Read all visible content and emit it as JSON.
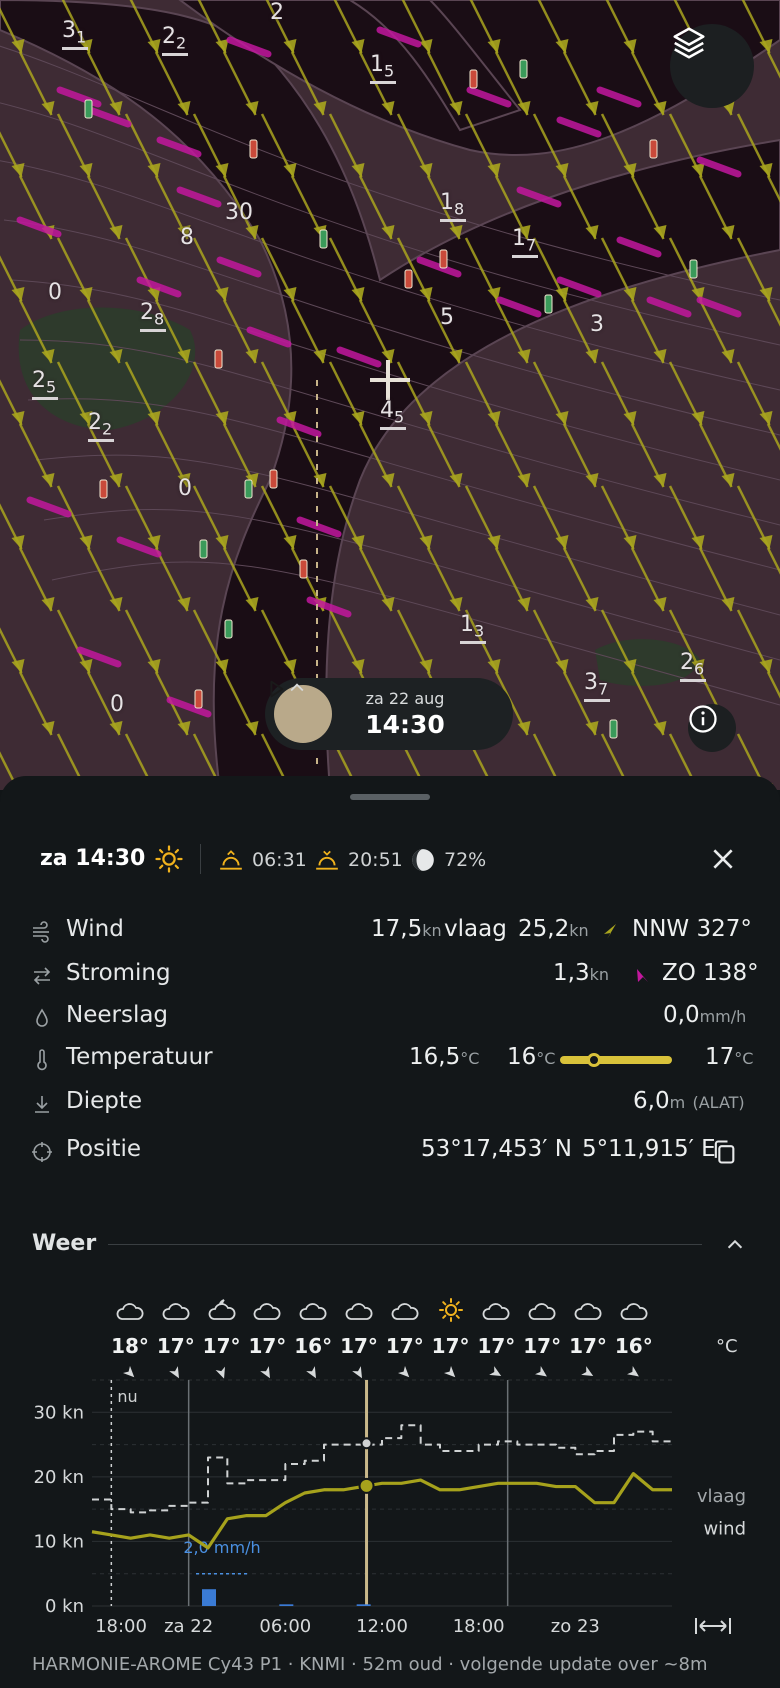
{
  "map": {
    "depth_labels": [
      {
        "main": "3",
        "sub": "1"
      },
      {
        "main": "2",
        "sub": "2"
      },
      {
        "main": "1",
        "sub": "5"
      },
      {
        "main": "1",
        "sub": "8"
      },
      {
        "main": "1",
        "sub": "7"
      },
      {
        "main": "2",
        "sub": "8"
      },
      {
        "main": "2",
        "sub": "5"
      },
      {
        "main": "2",
        "sub": "2"
      },
      {
        "main": "4",
        "sub": "5"
      },
      {
        "main": "1",
        "sub": "3"
      },
      {
        "main": "3",
        "sub": "7"
      },
      {
        "main": "2",
        "sub": "6"
      },
      {
        "main": "0",
        "sub": ""
      },
      {
        "main": "0",
        "sub": ""
      },
      {
        "main": "0",
        "sub": ""
      },
      {
        "main": "30",
        "sub": ""
      },
      {
        "main": "5",
        "sub": ""
      },
      {
        "main": "3",
        "sub": ""
      },
      {
        "main": "8",
        "sub": ""
      },
      {
        "main": "2",
        "sub": ""
      }
    ],
    "layers_icon": "layers-icon",
    "info_icon": "info-icon"
  },
  "timepill": {
    "date": "za 22 aug",
    "time": "14:30",
    "play_icon": "play-icon",
    "chevron_icon": "chevron-up-icon"
  },
  "sheet": {
    "header": {
      "title": "za 14:30",
      "sunrise": "06:31",
      "sunset": "20:51",
      "moon_pct": "72%"
    },
    "rows": {
      "wind": {
        "label": "Wind",
        "speed": "17,5",
        "speed_unit": "kn",
        "gust_label": "vlaag",
        "gust": "25,2",
        "gust_unit": "kn",
        "dir": "NNW 327°"
      },
      "current": {
        "label": "Stroming",
        "speed": "1,3",
        "unit": "kn",
        "dir": "ZO 138°"
      },
      "rain": {
        "label": "Neerslag",
        "value": "0,0",
        "unit": "mm/h"
      },
      "temp": {
        "label": "Temperatuur",
        "value": "16,5",
        "unit": "°C",
        "min": "16",
        "max": "17",
        "unit2": "°C",
        "unit3": "°C",
        "position_fraction": 0.3
      },
      "depth": {
        "label": "Diepte",
        "value": "6,0",
        "unit": "m",
        "ref": "(ALAT)"
      },
      "position": {
        "label": "Positie",
        "lat": "53°17,453′ N",
        "lon": "5°11,915′ E"
      }
    },
    "weather": {
      "section_title": "Weer",
      "temp_unit": "°C",
      "forecast": [
        {
          "icon": "cloud-icon",
          "temp": "18°"
        },
        {
          "icon": "cloud-icon",
          "temp": "17°"
        },
        {
          "icon": "moon-cloud-icon",
          "temp": "17°"
        },
        {
          "icon": "cloud-icon",
          "temp": "17°"
        },
        {
          "icon": "cloud-icon",
          "temp": "16°"
        },
        {
          "icon": "cloud-icon",
          "temp": "17°"
        },
        {
          "icon": "cloud-icon",
          "temp": "17°"
        },
        {
          "icon": "sun-icon",
          "temp": "17°"
        },
        {
          "icon": "cloud-icon",
          "temp": "17°"
        },
        {
          "icon": "cloud-icon",
          "temp": "17°"
        },
        {
          "icon": "cloud-icon",
          "temp": "17°"
        },
        {
          "icon": "cloud-icon",
          "temp": "16°"
        }
      ],
      "chart_data": {
        "type": "line",
        "y_ticks": [
          "30 kn",
          "20 kn",
          "10 kn",
          "0 kn"
        ],
        "ylim": [
          0,
          35
        ],
        "x_ticks": [
          "18:00",
          "za 22",
          "06:00",
          "12:00",
          "18:00",
          "zo 23"
        ],
        "now_label": "nu",
        "rain_annotation": "2,0 mm/h",
        "series": [
          {
            "name": "vlaag",
            "style": "dashed",
            "color": "#cfd2d3",
            "values": [
              16.5,
              15,
              14.5,
              14.8,
              15.5,
              16,
              23,
              19,
              19.5,
              19.5,
              22,
              22.5,
              25,
              25,
              25,
              26,
              28,
              25,
              24,
              24,
              25,
              25.5,
              25,
              25,
              24.5,
              23.5,
              24,
              26.5,
              27,
              25.5,
              25
            ]
          },
          {
            "name": "wind",
            "style": "solid",
            "color": "#a6a21c",
            "values": [
              11.5,
              11,
              10.5,
              11,
              10.5,
              11,
              9,
              13.5,
              14,
              14,
              16,
              17.5,
              18,
              18,
              18.5,
              19,
              19,
              19.5,
              18,
              18,
              18.5,
              19,
              19,
              19,
              18.5,
              18.5,
              16,
              16,
              20.5,
              18,
              18
            ]
          }
        ],
        "rain_bars": [
          0,
          0,
          0,
          0,
          0,
          0,
          2.0,
          0,
          0,
          0,
          0.2,
          0,
          0,
          0,
          0.2,
          0,
          0,
          0,
          0,
          0,
          0,
          0,
          0,
          0,
          0,
          0,
          0,
          0,
          0,
          0,
          0
        ],
        "expand_icon": "expand-horizontal-icon"
      }
    },
    "footer": "HARMONIE-AROME Cy43 P1 · KNMI · 52m oud · volgende update over ~8m"
  },
  "colors": {
    "wind_arrows": "#a9a51e",
    "current_arrows": "#c2189d",
    "accent_sun": "#f0b21d",
    "temp_bar": "#d9c23a",
    "rain": "#3a7bd5"
  }
}
